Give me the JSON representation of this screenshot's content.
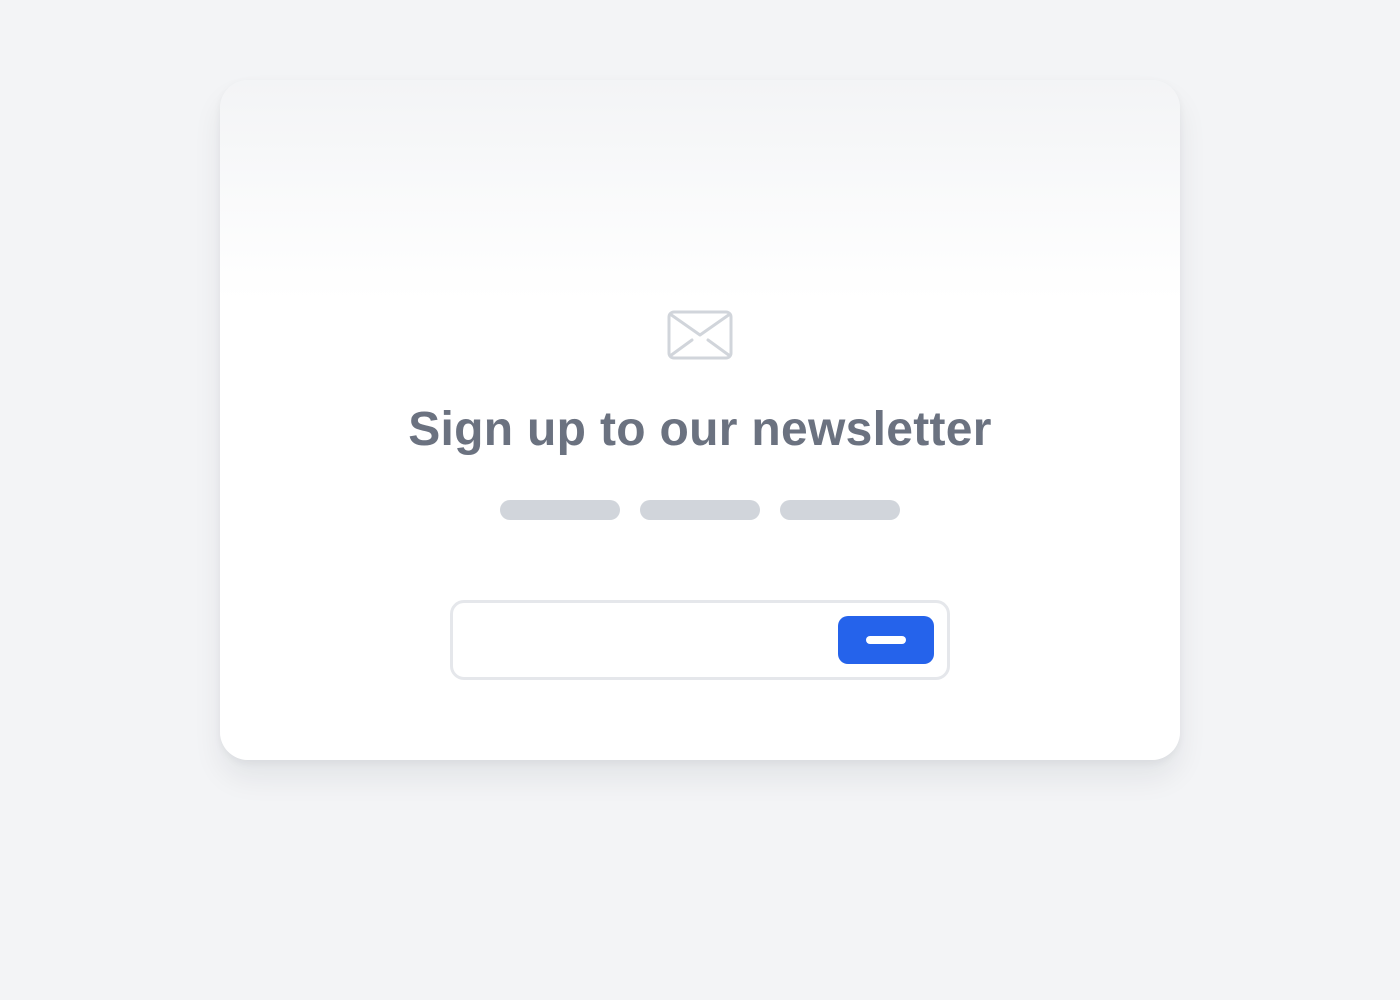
{
  "colors": {
    "page_background": "#f3f4f6",
    "card_background": "#ffffff",
    "title_text": "#6b7280",
    "icon_stroke": "#d1d5db",
    "placeholder_pill": "#d1d5db",
    "input_border": "#e5e7eb",
    "accent": "#2563eb",
    "button_mark": "#ffffff"
  },
  "card": {
    "icon": "envelope-icon",
    "title": "Sign up to our newsletter",
    "skeleton_pills": [
      "placeholder-line",
      "placeholder-line",
      "placeholder-line"
    ]
  },
  "form": {
    "email_value": "",
    "email_placeholder": "",
    "submit_icon": "dash-mark"
  }
}
